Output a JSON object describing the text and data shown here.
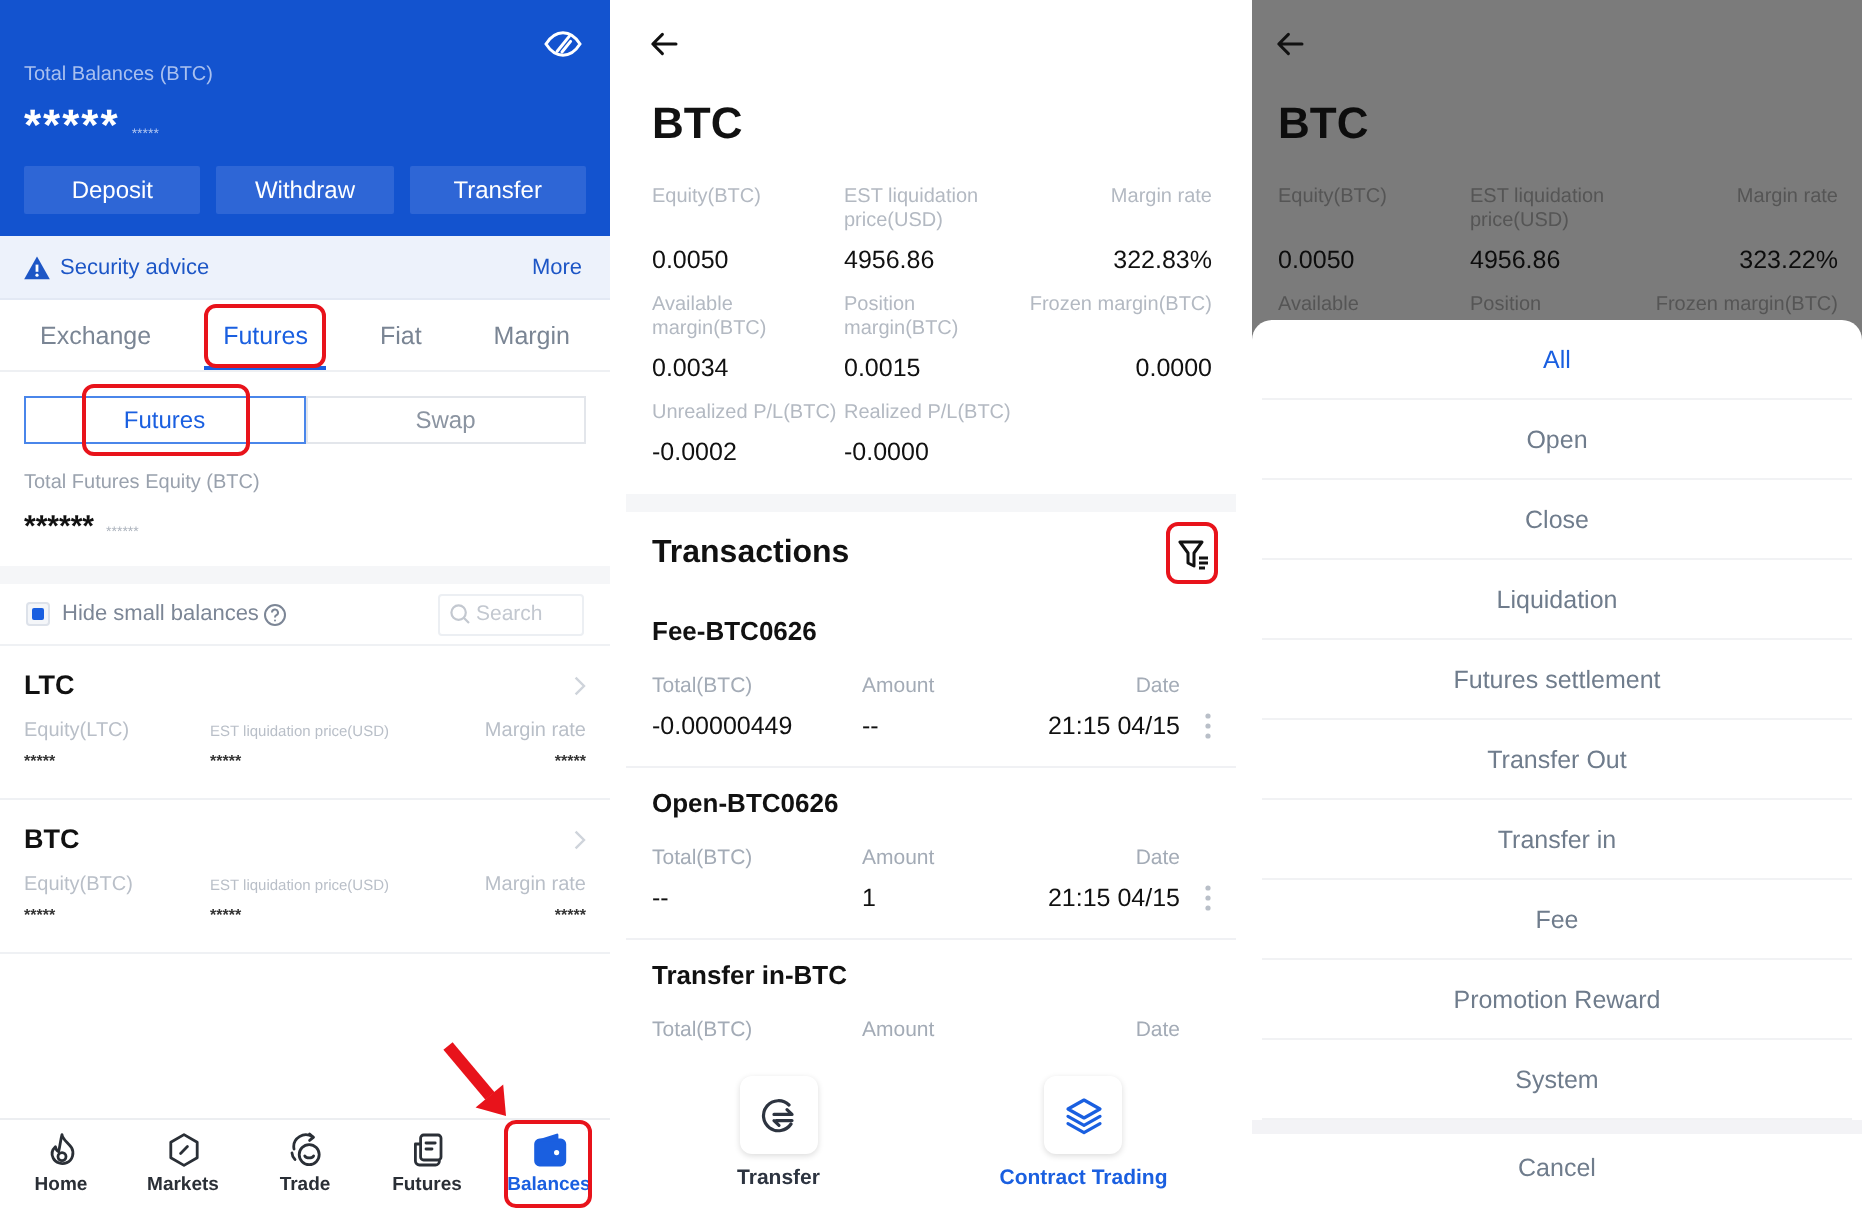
{
  "balances_screen": {
    "header": {
      "label": "Total Balances (BTC)",
      "value": "*****",
      "sub_value": "*****",
      "actions": [
        "Deposit",
        "Withdraw",
        "Transfer"
      ]
    },
    "notice": {
      "text": "Security advice",
      "link": "More"
    },
    "tabs": [
      {
        "label": "Exchange",
        "selected": false,
        "highlighted": false
      },
      {
        "label": "Futures",
        "selected": true,
        "highlighted": true
      },
      {
        "label": "Fiat",
        "selected": false,
        "highlighted": false
      },
      {
        "label": "Margin",
        "selected": false,
        "highlighted": false
      }
    ],
    "segments": [
      {
        "label": "Futures",
        "selected": true,
        "highlighted": true
      },
      {
        "label": "Swap",
        "selected": false,
        "highlighted": false
      }
    ],
    "equity": {
      "label": "Total Futures Equity (BTC)",
      "value": "******",
      "sub_value": "******"
    },
    "hide_small": {
      "label": "Hide small balances",
      "checked": true
    },
    "search": {
      "placeholder": "Search"
    },
    "accounts": [
      {
        "name": "LTC",
        "fields": [
          {
            "label": "Equity(LTC)",
            "value": "*****"
          },
          {
            "label": "EST liquidation price(USD)",
            "value": "*****"
          },
          {
            "label": "Margin rate",
            "value": "*****"
          }
        ]
      },
      {
        "name": "BTC",
        "fields": [
          {
            "label": "Equity(BTC)",
            "value": "*****"
          },
          {
            "label": "EST liquidation price(USD)",
            "value": "*****"
          },
          {
            "label": "Margin rate",
            "value": "*****"
          }
        ]
      }
    ],
    "nav": [
      {
        "label": "Home",
        "selected": false,
        "highlighted": false,
        "arrow": false
      },
      {
        "label": "Markets",
        "selected": false,
        "highlighted": false,
        "arrow": false
      },
      {
        "label": "Trade",
        "selected": false,
        "highlighted": false,
        "arrow": false
      },
      {
        "label": "Futures",
        "selected": false,
        "highlighted": false,
        "arrow": false
      },
      {
        "label": "Balances",
        "selected": true,
        "highlighted": true,
        "arrow": true
      }
    ]
  },
  "detail_screen": {
    "title": "BTC",
    "stats": [
      {
        "label": "Equity(BTC)",
        "value": "0.0050"
      },
      {
        "label": "EST liquidation price(USD)",
        "value": "4956.86"
      },
      {
        "label": "Margin rate",
        "value": "322.83%"
      },
      {
        "label": "Available margin(BTC)",
        "value": "0.0034"
      },
      {
        "label": "Position margin(BTC)",
        "value": "0.0015"
      },
      {
        "label": "Frozen margin(BTC)",
        "value": "0.0000"
      },
      {
        "label": "Unrealized P/L(BTC)",
        "value": "-0.0002"
      },
      {
        "label": "Realized P/L(BTC)",
        "value": "-0.0000"
      }
    ],
    "section_title": "Transactions",
    "filter_button": {
      "highlighted": true
    },
    "transactions": [
      {
        "title": "Fee-BTC0626",
        "columns": [
          {
            "label": "Total(BTC)",
            "value": "-0.00000449"
          },
          {
            "label": "Amount",
            "value": "--"
          },
          {
            "label": "Date",
            "value": "21:15 04/15"
          }
        ]
      },
      {
        "title": "Open-BTC0626",
        "columns": [
          {
            "label": "Total(BTC)",
            "value": "--"
          },
          {
            "label": "Amount",
            "value": "1"
          },
          {
            "label": "Date",
            "value": "21:15 04/15"
          }
        ]
      },
      {
        "title": "Transfer in-BTC",
        "columns": [
          {
            "label": "Total(BTC)"
          },
          {
            "label": "Amount"
          },
          {
            "label": "Date"
          }
        ]
      }
    ],
    "actions": [
      {
        "label": "Transfer",
        "selected": false
      },
      {
        "label": "Contract Trading",
        "selected": true
      }
    ]
  },
  "filter_sheet_screen": {
    "backdrop": {
      "title": "BTC",
      "stats": [
        {
          "label": "Equity(BTC)",
          "value": "0.0050"
        },
        {
          "label": "EST liquidation price(USD)",
          "value": "4956.86"
        },
        {
          "label": "Margin rate",
          "value": "323.22%"
        }
      ],
      "cut_labels": [
        "Available",
        "Position",
        "Frozen margin(BTC)"
      ]
    },
    "options": [
      {
        "label": "All",
        "selected": true
      },
      {
        "label": "Open",
        "selected": false
      },
      {
        "label": "Close",
        "selected": false
      },
      {
        "label": "Liquidation",
        "selected": false
      },
      {
        "label": "Futures settlement",
        "selected": false
      },
      {
        "label": "Transfer Out",
        "selected": false
      },
      {
        "label": "Transfer in",
        "selected": false
      },
      {
        "label": "Fee",
        "selected": false
      },
      {
        "label": "Promotion Reward",
        "selected": false
      },
      {
        "label": "System",
        "selected": false
      }
    ],
    "cancel": "Cancel"
  }
}
